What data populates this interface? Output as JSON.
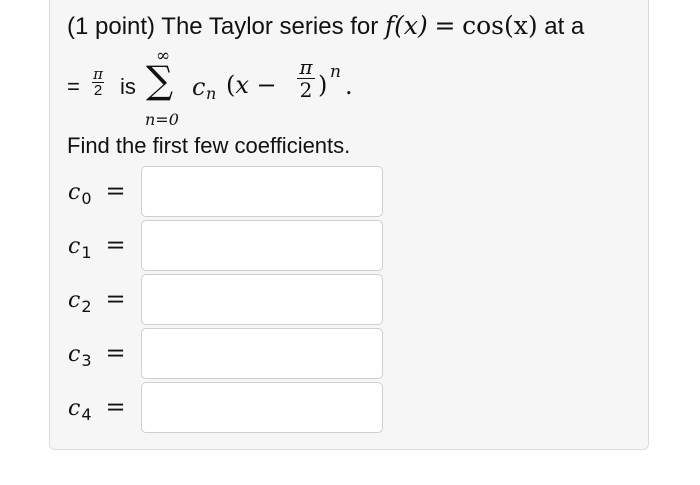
{
  "question": {
    "prefix": "(1 point) The Taylor series for",
    "function_lhs": "f(x)",
    "equals": "=",
    "function_rhs": "cos(x)",
    "suffix": "at a",
    "line2_eq": "=",
    "pi": "π",
    "two": "2",
    "is_word": "is",
    "sum_upper": "∞",
    "sum_symbol": "∑",
    "sum_lower": "n=0",
    "term_coef": "c",
    "term_coef_sub": "n",
    "term_open": "(x −",
    "term_close": ")",
    "term_power": "n",
    "period": ".",
    "instruction": "Find the first few coefficients."
  },
  "coefficients": [
    {
      "var": "c",
      "sub": "0",
      "eq": "=",
      "value": ""
    },
    {
      "var": "c",
      "sub": "1",
      "eq": "=",
      "value": ""
    },
    {
      "var": "c",
      "sub": "2",
      "eq": "=",
      "value": ""
    },
    {
      "var": "c",
      "sub": "3",
      "eq": "=",
      "value": ""
    },
    {
      "var": "c",
      "sub": "4",
      "eq": "=",
      "value": ""
    }
  ]
}
